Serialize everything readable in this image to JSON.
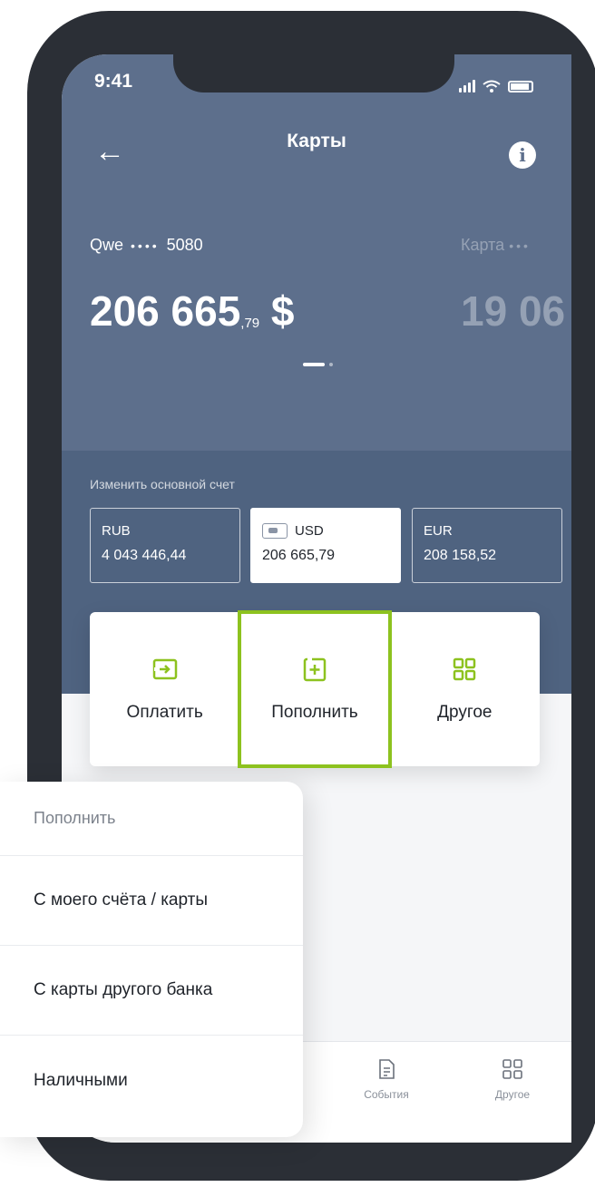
{
  "status_bar": {
    "time": "9:41"
  },
  "header": {
    "title": "Карты"
  },
  "cards": [
    {
      "name": "Qwe",
      "masked": "••••",
      "last4": "5080",
      "balance_main": "206 665",
      "balance_cents": ",79",
      "currency_symbol": "$"
    },
    {
      "name": "Карта",
      "masked": "•••",
      "balance_partial": "19 06"
    }
  ],
  "account_switch": {
    "label": "Изменить основной счет",
    "accounts": [
      {
        "currency": "RUB",
        "amount": "4 043 446,44",
        "selected": false
      },
      {
        "currency": "USD",
        "amount": "206 665,79",
        "selected": true
      },
      {
        "currency": "EUR",
        "amount": "208 158,52",
        "selected": false
      }
    ]
  },
  "actions": [
    {
      "label": "Оплатить",
      "icon": "pay-icon"
    },
    {
      "label": "Пополнить",
      "icon": "top-up-icon",
      "highlighted": true
    },
    {
      "label": "Другое",
      "icon": "grid-icon"
    }
  ],
  "menu": {
    "header": "Пополнить",
    "items": [
      "С моего счёта / карты",
      "С карты другого банка",
      "Наличными"
    ]
  },
  "tabbar": {
    "items": [
      {
        "label": "События",
        "icon": "document-icon"
      },
      {
        "label": "Другое",
        "icon": "grid-icon"
      }
    ]
  },
  "colors": {
    "header_bg": "#5d6f8c",
    "accent_green": "#8dc21f"
  }
}
